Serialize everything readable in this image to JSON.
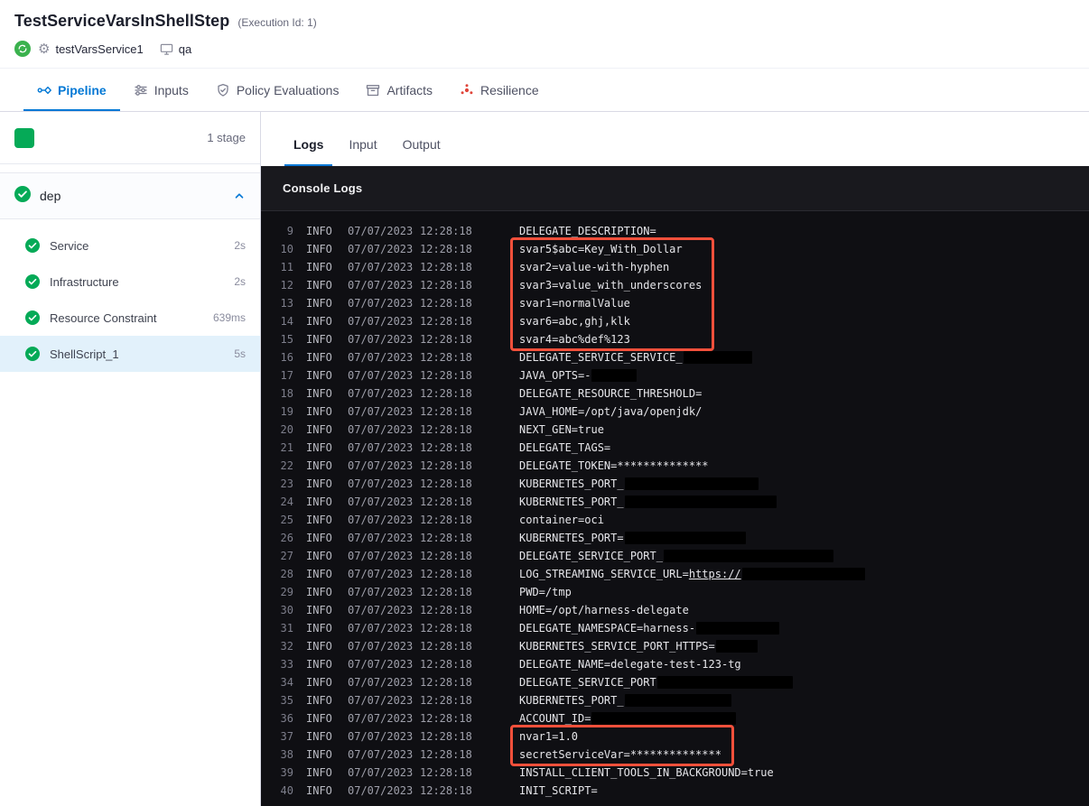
{
  "colors": {
    "accent": "#0278d5",
    "success": "#05aa57",
    "highlight": "#f3503b",
    "sel": "#e2f1fb",
    "console_bg": "#0f0f13",
    "console_header_bg": "#19191e",
    "redact": "#000000"
  },
  "header": {
    "title": "TestServiceVarsInShellStep",
    "execution_id": "(Execution Id: 1)",
    "service_name": "testVarsService1",
    "environment_name": "qa"
  },
  "nav_tabs": [
    {
      "label": "Pipeline",
      "icon": "pipeline",
      "active": true
    },
    {
      "label": "Inputs",
      "icon": "inputs",
      "active": false
    },
    {
      "label": "Policy Evaluations",
      "icon": "policy",
      "active": false
    },
    {
      "label": "Artifacts",
      "icon": "artifacts",
      "active": false
    },
    {
      "label": "Resilience",
      "icon": "resilience",
      "active": false
    }
  ],
  "sidebar": {
    "stage_count": "1 stage",
    "stage_name": "dep",
    "steps": [
      {
        "name": "Service",
        "duration": "2s",
        "selected": false
      },
      {
        "name": "Infrastructure",
        "duration": "2s",
        "selected": false
      },
      {
        "name": "Resource Constraint",
        "duration": "639ms",
        "selected": false
      },
      {
        "name": "ShellScript_1",
        "duration": "5s",
        "selected": true
      }
    ]
  },
  "main": {
    "tabs": [
      {
        "label": "Logs",
        "active": true
      },
      {
        "label": "Input",
        "active": false
      },
      {
        "label": "Output",
        "active": false
      }
    ],
    "console_title": "Console Logs",
    "log": {
      "level": "INFO",
      "date": "07/07/2023",
      "time": "12:28:18",
      "lines": [
        {
          "n": "9",
          "msg": "DELEGATE_DESCRIPTION="
        },
        {
          "n": "10",
          "msg": "svar5$abc=Key_With_Dollar",
          "hl": 1
        },
        {
          "n": "11",
          "msg": "svar2=value-with-hyphen",
          "hl": 1
        },
        {
          "n": "12",
          "msg": "svar3=value_with_underscores",
          "hl": 1
        },
        {
          "n": "13",
          "msg": "svar1=normalValue",
          "hl": 1
        },
        {
          "n": "14",
          "msg": "svar6=abc,ghj,klk",
          "hl": 1
        },
        {
          "n": "15",
          "msg": "svar4=abc%def%123",
          "hl": 1
        },
        {
          "n": "16",
          "msg": "DELEGATE_SERVICE_SERVICE_",
          "redact": 76
        },
        {
          "n": "17",
          "msg": "JAVA_OPTS=-",
          "redact": 50
        },
        {
          "n": "18",
          "msg": "DELEGATE_RESOURCE_THRESHOLD="
        },
        {
          "n": "19",
          "msg": "JAVA_HOME=/opt/java/openjdk/"
        },
        {
          "n": "20",
          "msg": "NEXT_GEN=true"
        },
        {
          "n": "21",
          "msg": "DELEGATE_TAGS="
        },
        {
          "n": "22",
          "msg": "DELEGATE_TOKEN=**************"
        },
        {
          "n": "23",
          "msg": "KUBERNETES_PORT_",
          "redact": 148
        },
        {
          "n": "24",
          "msg": "KUBERNETES_PORT_",
          "redact": 168
        },
        {
          "n": "25",
          "msg": "container=oci"
        },
        {
          "n": "26",
          "msg": "KUBERNETES_PORT=",
          "redact": 134
        },
        {
          "n": "27",
          "msg": "DELEGATE_SERVICE_PORT_",
          "redact": 188
        },
        {
          "n": "28",
          "msg": "LOG_STREAMING_SERVICE_URL=",
          "link": "https://",
          "redact": 136
        },
        {
          "n": "29",
          "msg": "PWD=/tmp"
        },
        {
          "n": "30",
          "msg": "HOME=/opt/harness-delegate"
        },
        {
          "n": "31",
          "msg": "DELEGATE_NAMESPACE=harness-",
          "redact": 92
        },
        {
          "n": "32",
          "msg": "KUBERNETES_SERVICE_PORT_HTTPS=",
          "redact": 46
        },
        {
          "n": "33",
          "msg": "DELEGATE_NAME=delegate-test-123-tg"
        },
        {
          "n": "34",
          "msg": "DELEGATE_SERVICE_PORT",
          "redact": 150
        },
        {
          "n": "35",
          "msg": "KUBERNETES_PORT_",
          "redact": 118
        },
        {
          "n": "36",
          "msg": "ACCOUNT_ID=",
          "redact": 160
        },
        {
          "n": "37",
          "msg": "nvar1=1.0",
          "hl": 2
        },
        {
          "n": "38",
          "msg": "secretServiceVar=**************",
          "hl": 2
        },
        {
          "n": "39",
          "msg": "INSTALL_CLIENT_TOOLS_IN_BACKGROUND=true"
        },
        {
          "n": "40",
          "msg": "INIT_SCRIPT="
        }
      ]
    }
  }
}
